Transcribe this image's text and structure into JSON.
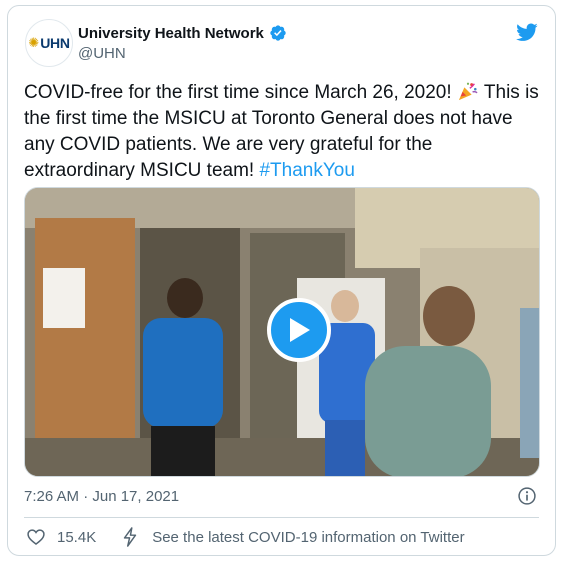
{
  "account": {
    "logo_text": "UHN",
    "display_name": "University Health Network",
    "handle": "@UHN"
  },
  "icons": {
    "verified": "verified-badge-icon",
    "platform": "twitter-bird-icon",
    "info": "info-icon",
    "like": "heart-icon",
    "covid": "lightning-bolt-icon",
    "media": "play-icon"
  },
  "tweet": {
    "line_1": "COVID-free for the first time since March 26, 2020!",
    "line_2": "This is the first time the MSICU at Toronto General does not have any COVID patients. We are very grateful for the extraordinary MSICU team!",
    "hashtag": "#ThankYou"
  },
  "meta": {
    "timestamp": "7:26 AM · Jun 17, 2021"
  },
  "actions": {
    "like_count": "15.4K",
    "covid_link": "See the latest COVID-19 information on Twitter"
  },
  "colors": {
    "accent": "#1d9bf0",
    "text": "#0f1419",
    "secondary": "#536471",
    "border": "#cfd9de"
  }
}
